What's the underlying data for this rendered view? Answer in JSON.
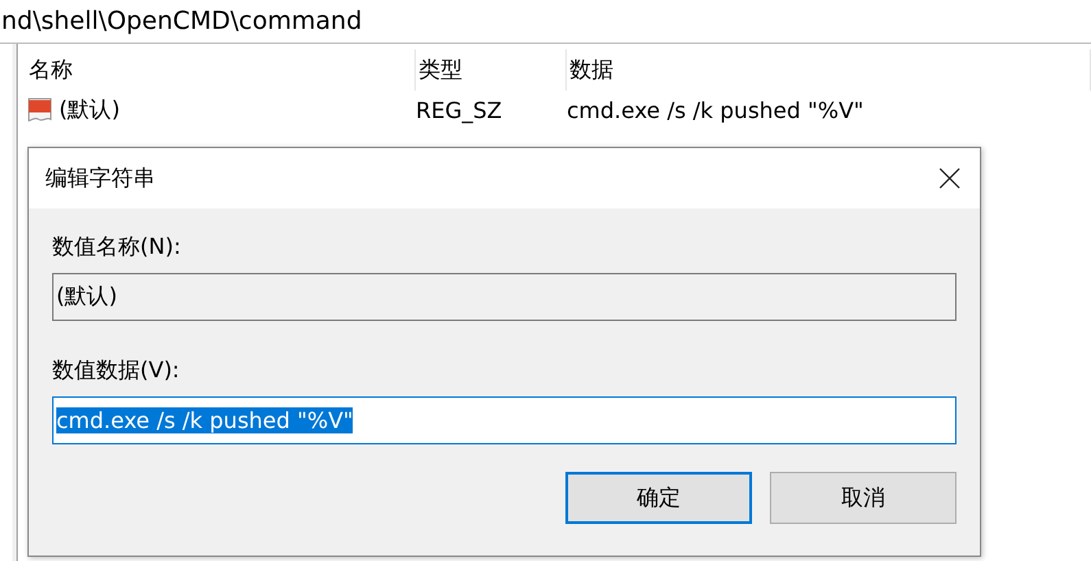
{
  "address_bar": {
    "path": "nd\\shell\\OpenCMD\\command"
  },
  "table": {
    "columns": [
      "名称",
      "类型",
      "数据"
    ],
    "rows": [
      {
        "name": "(默认)",
        "type": "REG_SZ",
        "data": "cmd.exe /s /k pushed \"%V\"",
        "kind": "string"
      }
    ]
  },
  "dialog": {
    "title": "编辑字符串",
    "name_label": "数值名称(N):",
    "name_value": "(默认)",
    "data_label": "数值数据(V):",
    "data_value": "cmd.exe /s /k pushed \"%V\"",
    "data_selected": true,
    "buttons": [
      {
        "label": "确定",
        "default": true
      },
      {
        "label": "取消",
        "default": false
      }
    ]
  }
}
